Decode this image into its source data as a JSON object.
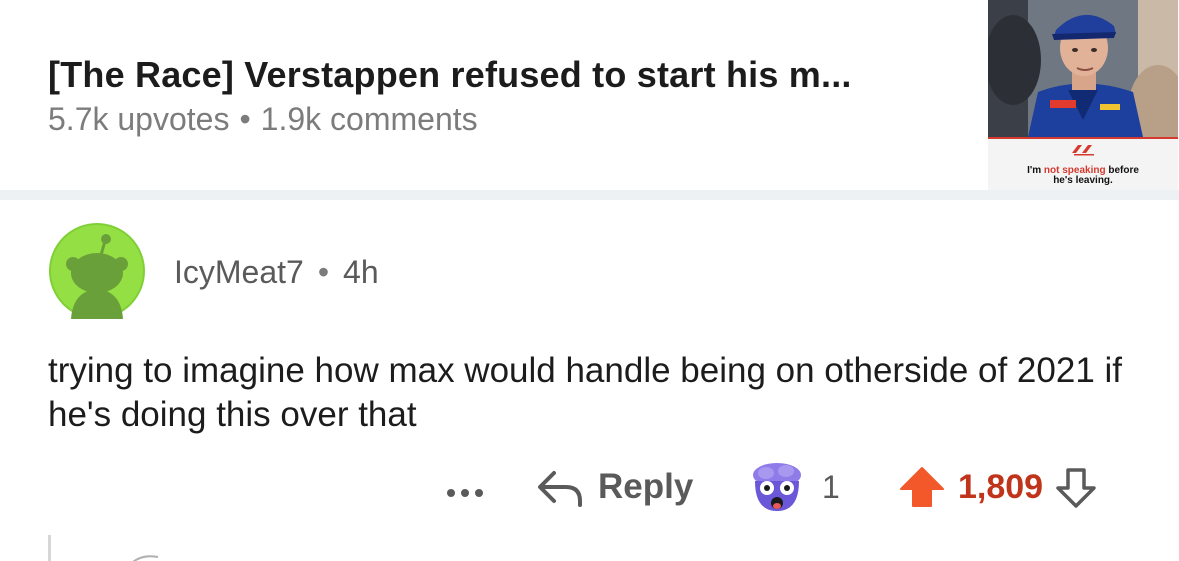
{
  "post": {
    "title": "[The Race] Verstappen refused to start his m...",
    "upvotes": "5.7k upvotes",
    "separator": "•",
    "comments": "1.9k comments",
    "thumbnail": {
      "caption_normal_1": "I'm ",
      "caption_red": "not speaking",
      "caption_normal_2": " before",
      "caption_line2": "he's leaving."
    }
  },
  "comment": {
    "author": "IcyMeat7",
    "separator": "•",
    "time": "4h",
    "body": "trying to imagine how max would handle being on otherside of 2021 if he's doing this over that",
    "actions": {
      "more_label": "...",
      "reply_label": "Reply",
      "award_count": "1",
      "vote_count": "1,809"
    }
  },
  "colors": {
    "upvote": "#f2582a",
    "vote_text": "#c1341c",
    "avatar_bg": "#94e044",
    "muted_text": "#7c7c7c"
  }
}
